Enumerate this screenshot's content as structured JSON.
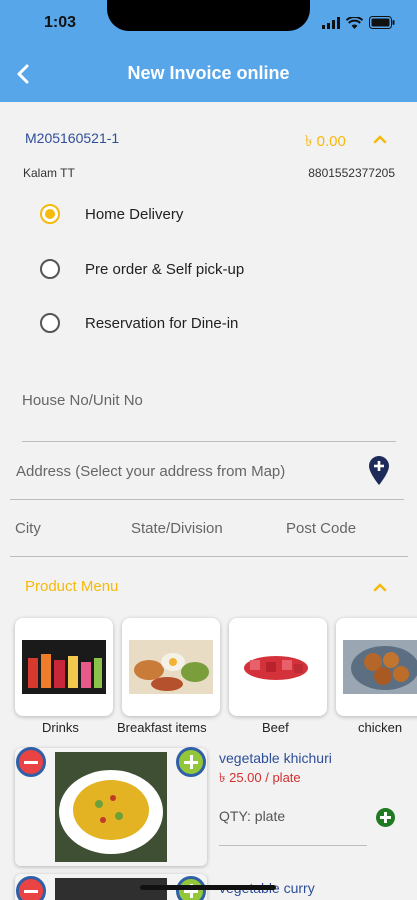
{
  "status": {
    "time": "1:03"
  },
  "header": {
    "title": "New Invoice online"
  },
  "invoice": {
    "id": "M205160521-1",
    "amount": "৳ 0.00",
    "customer_name": "Kalam TT",
    "customer_phone": "8801552377205"
  },
  "delivery_options": [
    {
      "label": "Home Delivery",
      "selected": true
    },
    {
      "label": "Pre order & Self pick-up",
      "selected": false
    },
    {
      "label": "Reservation for Dine-in",
      "selected": false
    }
  ],
  "address_form": {
    "house_placeholder": "House No/Unit No",
    "address_placeholder": "Address (Select your address from Map)",
    "city_placeholder": "City",
    "state_placeholder": "State/Division",
    "postcode_placeholder": "Post Code"
  },
  "product_menu": {
    "title": "Product Menu",
    "categories": [
      {
        "label": "Drinks"
      },
      {
        "label": "Breakfast  items"
      },
      {
        "label": "Beef"
      },
      {
        "label": "chicken"
      }
    ]
  },
  "products": [
    {
      "name": "vegetable khichuri",
      "price": "৳ 25.00 / plate",
      "qty_label": "QTY: plate"
    },
    {
      "name": "vegetable  curry"
    }
  ],
  "colors": {
    "header": "#58a6ea",
    "accent": "#f6b90d",
    "link": "#2e4e9a",
    "price": "#d32f2f",
    "add": "#1f7a22"
  }
}
